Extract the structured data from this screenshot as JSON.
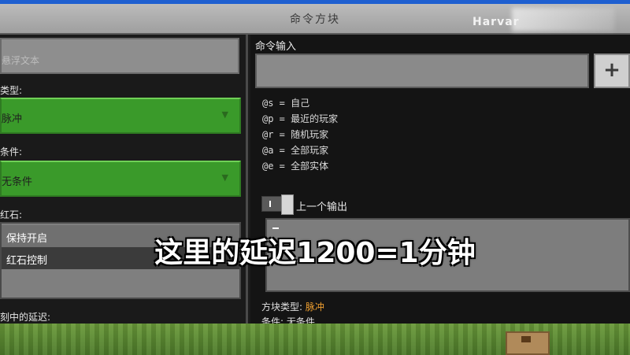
{
  "window": {
    "title": "命令方块",
    "watermark": "Harvar"
  },
  "left": {
    "text_placeholder": "悬浮文本",
    "block_type_label": "类型:",
    "block_type_value": "脉冲",
    "condition_label": "条件:",
    "condition_value": "无条件",
    "redstone_label": "红石:",
    "redstone_options": [
      "保持开启",
      "红石控制"
    ],
    "delay_label": "刻中的延迟:"
  },
  "right": {
    "command_input_label": "命令输入",
    "add_button": "+",
    "selectors": [
      "@s = 自己",
      "@p = 最近的玩家",
      "@r = 随机玩家",
      "@a = 全部玩家",
      "@e = 全部实体"
    ],
    "previous_output_label": "上一个输出",
    "previous_output_value": "—",
    "info_block_type_label": "方块类型:",
    "info_block_type_value": "脉冲",
    "info_condition": "条件: 无条件"
  },
  "subtitle": "这里的延迟1200=1分钟",
  "colors": {
    "green_dropdown": "#3a9a2a",
    "highlight": "#f0a030",
    "panel_bg": "#1a1a1a"
  }
}
